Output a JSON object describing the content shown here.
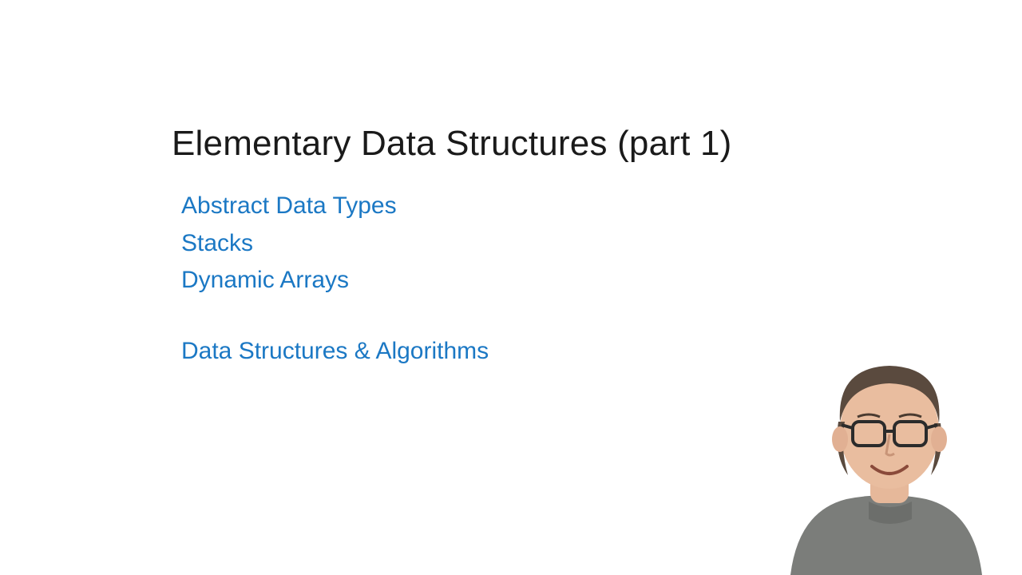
{
  "title": "Elementary Data Structures (part 1)",
  "topics": [
    "Abstract Data Types",
    "Stacks",
    "Dynamic Arrays"
  ],
  "course": "Data Structures & Algorithms",
  "colors": {
    "title": "#1a1a1a",
    "link": "#1b78c4",
    "background": "#ffffff"
  }
}
